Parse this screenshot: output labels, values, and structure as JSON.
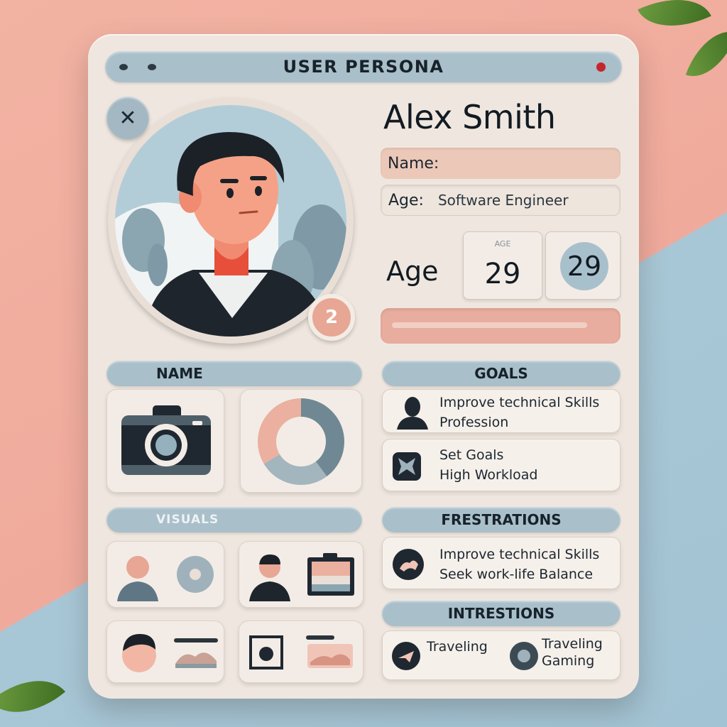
{
  "header": {
    "title": "USER PERSONA"
  },
  "profile": {
    "name_heading": "Alex Smith",
    "badge": "2",
    "name_label": "Name:",
    "name_value": "",
    "age_label_field": "Age:",
    "occupation": "Software Engineer",
    "age_label": "Age",
    "age_box_caption": "AGE",
    "age_value": "29",
    "age_circle_value": "29",
    "progress_fraction": 0.9
  },
  "sections": {
    "name": "NAME",
    "goals": "GOALS",
    "visuals": "VISUALS",
    "frustrations": "FRESTRATIONS",
    "interests": "INTRESTIONS"
  },
  "goals": [
    {
      "line1": "Improve technical Skills",
      "line2": "Profession"
    },
    {
      "line1": "Set Goals",
      "line2": "High Workload"
    }
  ],
  "frustrations": [
    {
      "line1": "Improve technical Skills",
      "line2": "Seek work-life Balance"
    }
  ],
  "interests": [
    {
      "label": "Traveling"
    },
    {
      "label": "Traveling",
      "label2": "Gaming"
    }
  ],
  "colors": {
    "card": "#efe7df",
    "bar": "#a9bfca",
    "accent_peach": "#e9ad9f",
    "close_red": "#c5262c"
  }
}
